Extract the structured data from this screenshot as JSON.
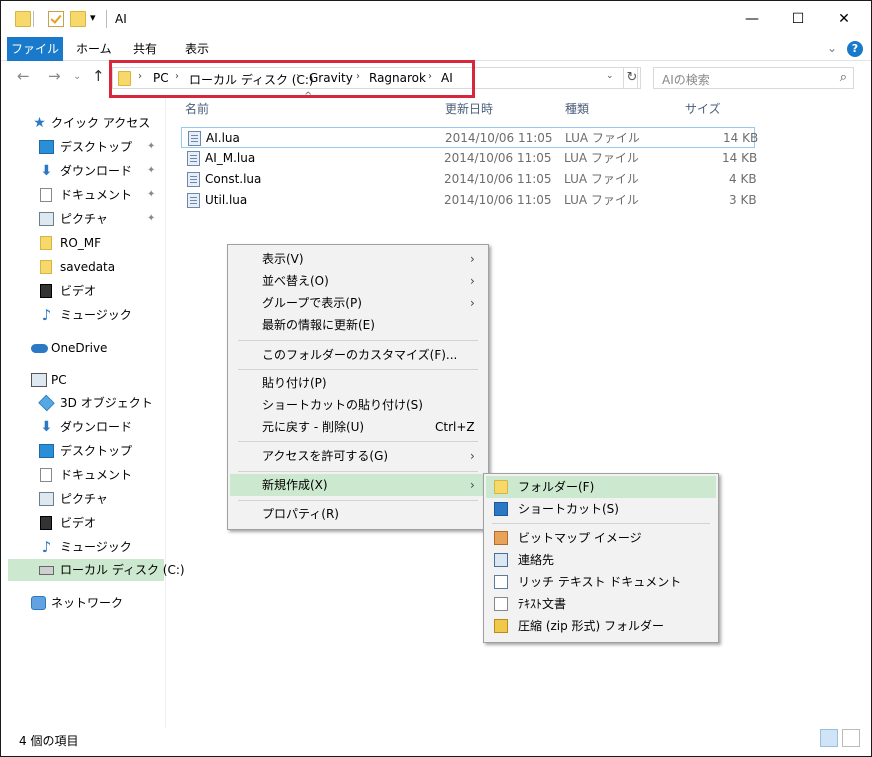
{
  "window": {
    "title": "AI",
    "minimize": "—",
    "maximize": "☐",
    "close": "✕"
  },
  "ribbon": {
    "tabs": [
      "ファイル",
      "ホーム",
      "共有",
      "表示"
    ],
    "collapse": "⌄",
    "help": "?"
  },
  "nav_buttons": {
    "back": "←",
    "forward": "→",
    "dropdown": "⌄",
    "up": "↑"
  },
  "address": {
    "crumbs": [
      "PC",
      "ローカル ディスク (C:)",
      "Gravity",
      "Ragnarok",
      "AI"
    ],
    "separator": "›",
    "dropdown": "⌄",
    "refresh": "↻"
  },
  "search": {
    "placeholder": "AIの検索",
    "icon": "⌕"
  },
  "sidebar": {
    "items": [
      {
        "label": "クイック アクセス",
        "icon": "star-icon"
      },
      {
        "label": "デスクトップ",
        "icon": "desktop-icon",
        "pinned": true
      },
      {
        "label": "ダウンロード",
        "icon": "download-icon",
        "pinned": true
      },
      {
        "label": "ドキュメント",
        "icon": "document-icon",
        "pinned": true
      },
      {
        "label": "ピクチャ",
        "icon": "pictures-icon",
        "pinned": true
      },
      {
        "label": "RO_MF",
        "icon": "folder-icon"
      },
      {
        "label": "savedata",
        "icon": "folder-icon"
      },
      {
        "label": "ビデオ",
        "icon": "video-icon"
      },
      {
        "label": "ミュージック",
        "icon": "music-icon"
      },
      {
        "label": "OneDrive",
        "icon": "cloud-icon"
      },
      {
        "label": "PC",
        "icon": "pc-icon"
      },
      {
        "label": "3D オブジェクト",
        "icon": "3d-objects-icon"
      },
      {
        "label": "ダウンロード",
        "icon": "download-icon"
      },
      {
        "label": "デスクトップ",
        "icon": "desktop-icon"
      },
      {
        "label": "ドキュメント",
        "icon": "document-icon"
      },
      {
        "label": "ピクチャ",
        "icon": "pictures-icon"
      },
      {
        "label": "ビデオ",
        "icon": "video-icon"
      },
      {
        "label": "ミュージック",
        "icon": "music-icon"
      },
      {
        "label": "ローカル ディスク (C:)",
        "icon": "drive-icon",
        "selected": true
      },
      {
        "label": "ネットワーク",
        "icon": "network-icon"
      }
    ],
    "pin_glyph": "📌"
  },
  "file_list": {
    "columns": [
      "名前",
      "更新日時",
      "種類",
      "サイズ"
    ],
    "sort_caret": "^",
    "rows": [
      {
        "name": "AI.lua",
        "modified": "2014/10/06 11:05",
        "type": "LUA ファイル",
        "size": "14 KB"
      },
      {
        "name": "AI_M.lua",
        "modified": "2014/10/06 11:05",
        "type": "LUA ファイル",
        "size": "14 KB"
      },
      {
        "name": "Const.lua",
        "modified": "2014/10/06 11:05",
        "type": "LUA ファイル",
        "size": "4 KB"
      },
      {
        "name": "Util.lua",
        "modified": "2014/10/06 11:05",
        "type": "LUA ファイル",
        "size": "3 KB"
      }
    ]
  },
  "context_menu": {
    "items": [
      {
        "label": "表示(V)",
        "submenu": true
      },
      {
        "label": "並べ替え(O)",
        "submenu": true
      },
      {
        "label": "グループで表示(P)",
        "submenu": true
      },
      {
        "label": "最新の情報に更新(E)"
      },
      {
        "label": "このフォルダーのカスタマイズ(F)..."
      },
      {
        "label": "貼り付け(P)"
      },
      {
        "label": "ショートカットの貼り付け(S)"
      },
      {
        "label": "元に戻す - 削除(U)",
        "shortcut": "Ctrl+Z"
      },
      {
        "label": "アクセスを許可する(G)",
        "submenu": true
      },
      {
        "label": "新規作成(X)",
        "submenu": true,
        "highlighted": true
      },
      {
        "label": "プロパティ(R)"
      }
    ],
    "arrow": "›"
  },
  "new_submenu": {
    "items": [
      {
        "label": "フォルダー(F)",
        "icon": "folder-icon",
        "highlighted": true
      },
      {
        "label": "ショートカット(S)",
        "icon": "shortcut-icon"
      },
      {
        "label": "ビットマップ イメージ",
        "icon": "bitmap-icon"
      },
      {
        "label": "連絡先",
        "icon": "contact-icon"
      },
      {
        "label": "リッチ テキスト ドキュメント",
        "icon": "rich-text-icon"
      },
      {
        "label": "ﾃｷｽﾄ文書",
        "icon": "text-document-icon"
      },
      {
        "label": "圧縮 (zip 形式) フォルダー",
        "icon": "zip-folder-icon"
      }
    ]
  },
  "status": {
    "item_count": "4 個の項目"
  },
  "colors": {
    "accent": "#1979ca",
    "highlight": "#cce8cf",
    "address_outline": "#d8263d"
  }
}
